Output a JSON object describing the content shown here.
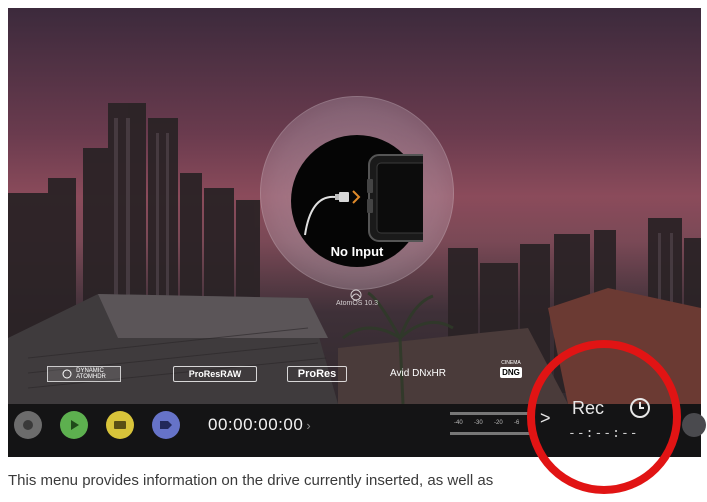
{
  "overlay": {
    "status_text": "No Input",
    "os_version": "AtomOS 10.3"
  },
  "codecs": {
    "atom_hdr_top": "DYNAMIC",
    "atom_hdr_bottom": "ATOMHDR",
    "prores_raw": "ProResRAW",
    "prores": "ProRes",
    "dnxhr": "Avid DNxHR",
    "cdng_top": "CINEMA",
    "cdng": "DNG"
  },
  "transport": {
    "timecode": "00:00:00:00",
    "timecode_chevron": "›",
    "meter_labels": [
      "-40",
      "-30",
      "-20",
      "-6"
    ]
  },
  "rec_panel": {
    "chevron": ">",
    "label": "Rec",
    "time": "--:--:--"
  },
  "caption": "This menu provides information on the drive currently inserted, as well as",
  "colors": {
    "record_button": "#6c6c6c",
    "play_button": "#5db04f",
    "monitor_button": "#d8c43a",
    "tag_button": "#6673c8",
    "highlight_ring": "#e11414"
  }
}
